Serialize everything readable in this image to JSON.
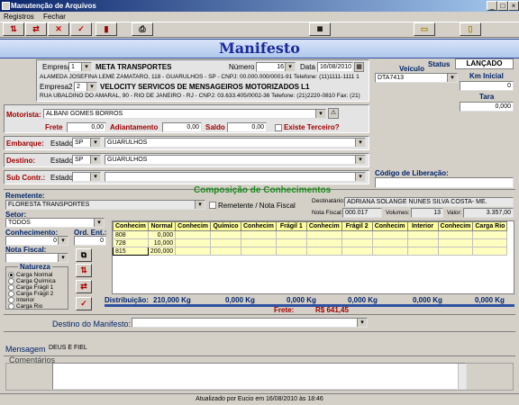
{
  "window": {
    "title": "Manutenção de Arquivos"
  },
  "menu": [
    "Registros",
    "Fechar"
  ],
  "toolbar_buttons": [
    "add-record",
    "prev-record",
    "delete-record",
    "confirm",
    "report",
    "print",
    "calculator",
    "folder",
    "document"
  ],
  "banner": {
    "title": "Manifesto"
  },
  "header": {
    "empresa_label": "Empresa",
    "empresa_num": "1",
    "empresa_name": "META TRANSPORTES",
    "empresa_address": "ALAMEDA JOSEFINA LEME ZAMATARO, 118 - GUARULHOS - SP - CNPJ: 00.000.000/0001-91 Telefone: (11)1111-1111 1",
    "empresa2_label": "Empresa2",
    "empresa2_num": "2",
    "empresa2_name": "VELOCITY SERVICOS DE MENSAGEIROS MOTORIZADOS L1",
    "empresa2_address": "RUA UBALDINO DO AMARAL, 90 - RIO DE JANEIRO - RJ - CNPJ: 03.633.405/0002-36 Telefone: (21)2220-0810 Fax: (21)",
    "numero_label": "Número",
    "numero": "16",
    "data_label": "Data",
    "data": "16/08/2010",
    "status_label": "Status",
    "status": "LANÇADO",
    "veiculo_label": "Veículo",
    "veiculo": "DTA7413",
    "km_label": "Km Inicial",
    "km": "0",
    "tara_label": "Tara",
    "tara": "0,000"
  },
  "motorista": {
    "label": "Motorista:",
    "value": "ALBANI GOMES BORROS",
    "frete_label": "Frete",
    "frete": "0,00",
    "adiantamento_label": "Adiantamento",
    "adiantamento": "0,00",
    "saldo_label": "Saldo",
    "saldo": "0,00",
    "terceiro_label": "Existe Terceiro?"
  },
  "embarque": {
    "label": "Embarque:",
    "estado_label": "Estado",
    "uf": "SP",
    "cidade": "GUARULHOS"
  },
  "destino": {
    "label": "Destino:",
    "estado_label": "Estado",
    "uf": "SP",
    "cidade": "GUARULHOS"
  },
  "subcontr": {
    "label": "Sub Contr.:",
    "estado_label": "Estado",
    "uf": "",
    "cidade": ""
  },
  "liberacao": {
    "label": "Código de Liberação:",
    "value": ""
  },
  "composicao": {
    "title": "Composição de Conhecimentos",
    "remetente_label": "Remetente:",
    "remetente": "FLORESTA TRANSPORTES",
    "remetente_nota_label": "Remetente / Nota Fiscal",
    "destinatario_label": "Destinatário:",
    "destinatario": "ADRIANA SOLANGE NUNES SILVA COSTA- ME.",
    "nota_fiscal_label": "Nota Fiscal:",
    "nota_fiscal": "000.017",
    "volumes_label": "Volumes:",
    "volumes": "13",
    "valor_label": "Valor:",
    "valor": "3.357,00",
    "setor_label": "Setor:",
    "setor": "TODOS",
    "conhecimento_label": "Conhecimento:",
    "conhecimento": "0",
    "ord_ent_label": "Ord. Ent.:",
    "ord_ent": "0",
    "nota_fiscal2_label": "Nota Fiscal:",
    "natureza_label": "Natureza",
    "natureza_options": [
      "Carga Normal",
      "Carga Química",
      "Carga Frágil 1",
      "Carga Frágil 2",
      "Interior",
      "Carga Rio"
    ],
    "natureza_selected": 0
  },
  "grid": {
    "headers": [
      "Conhecim",
      "Normal",
      "Conhecim",
      "Químico",
      "Conhecim",
      "Frágil 1",
      "Conhecim",
      "Frágil 2",
      "Conhecim",
      "Interior",
      "Conhecim",
      "Carga Rio"
    ],
    "rows": [
      [
        "808",
        "0,000",
        "",
        "",
        "",
        "",
        "",
        "",
        "",
        "",
        "",
        ""
      ],
      [
        "728",
        "10,000",
        "",
        "",
        "",
        "",
        "",
        "",
        "",
        "",
        "",
        ""
      ],
      [
        "815",
        "200,000",
        "",
        "",
        "",
        "",
        "",
        "",
        "",
        "",
        "",
        ""
      ]
    ]
  },
  "distribuicao": {
    "label": "Distribuição:",
    "values": [
      "210,000 Kg",
      "0,000 Kg",
      "0,000 Kg",
      "0,000 Kg",
      "0,000 Kg",
      "0,000 Kg"
    ],
    "frete_label": "Frete:",
    "frete": "R$ 641,45"
  },
  "destino_manifesto": {
    "label": "Destino do Manifesto:",
    "value": ""
  },
  "mensagem": {
    "label": "Mensagem",
    "value": "DEUS É FIEL"
  },
  "comentarios": {
    "label": "Comentários",
    "value": ""
  },
  "status_bar": "Atualizado por Eucio em 16/08/2010 às 18:46"
}
